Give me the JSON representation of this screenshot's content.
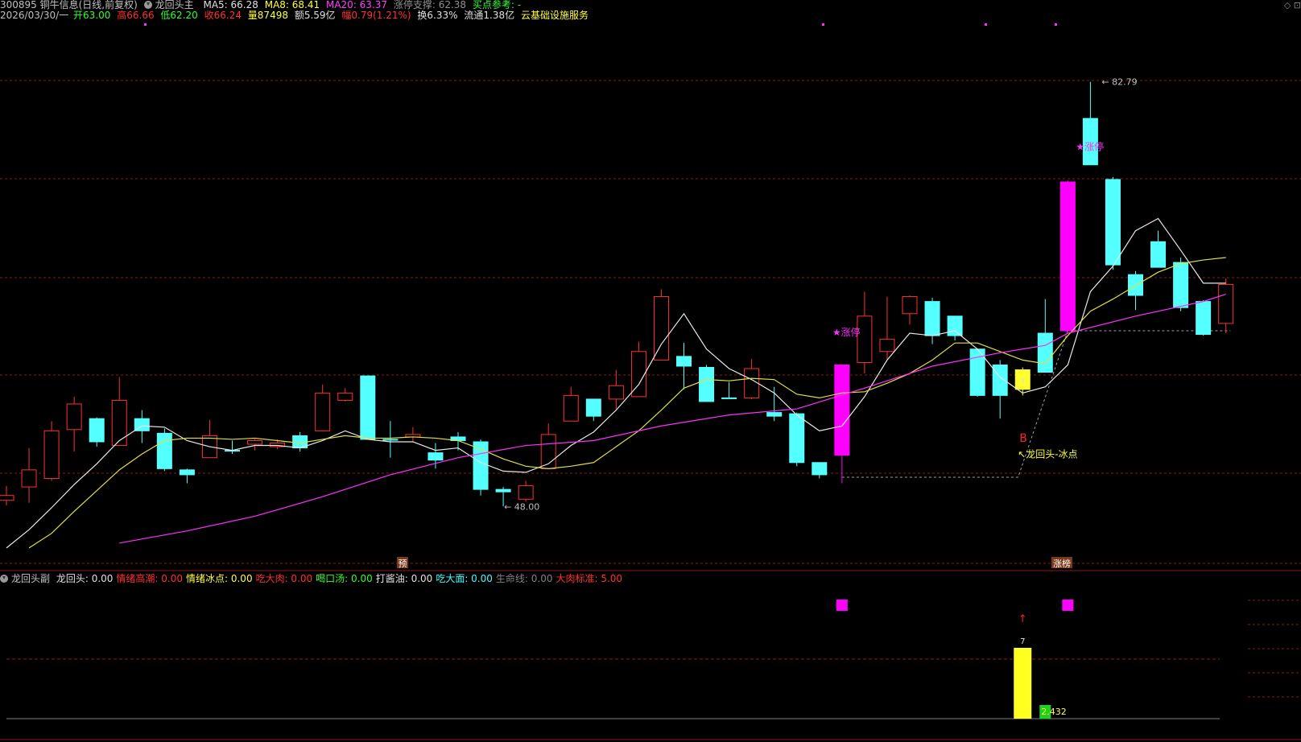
{
  "header": {
    "code_name": "300895 铜牛信息(日线,前复权)",
    "indicator_name": "龙回头主",
    "ma5": "MA5: 66.28",
    "ma8": "MA8: 68.41",
    "ma20": "MA20: 63.37",
    "limit_support": "涨停支撑: 62.38",
    "buy_ref": "买点参考: -",
    "date": "2026/03/30/一",
    "open": "开63.00",
    "high": "高66.66",
    "low": "低62.20",
    "close": "收66.24",
    "volume": "量87498",
    "amount": "额5.59亿",
    "change": "幅0.79(1.21%)",
    "turnover": "换6.33%",
    "float": "流通1.38亿",
    "concept": "云基础设施服务"
  },
  "sub_header": {
    "name": "龙回头副",
    "items": [
      {
        "label": "龙回头: 0.00",
        "color": "#e0e0e0"
      },
      {
        "label": "情绪高潮: 0.00",
        "color": "#ff3030"
      },
      {
        "label": "情绪冰点: 0.00",
        "color": "#ffff40"
      },
      {
        "label": "吃大肉: 0.00",
        "color": "#ff3030"
      },
      {
        "label": "喝口汤: 0.00",
        "color": "#30ff30"
      },
      {
        "label": "打酱油: 0.00",
        "color": "#e0e0e0"
      },
      {
        "label": "吃大面: 0.00",
        "color": "#40ffff"
      },
      {
        "label": "生命线: 0.00",
        "color": "#808080"
      },
      {
        "label": "大肉标准: 5.00",
        "color": "#ff3030"
      }
    ]
  },
  "top_right_icons": "◇ ⊡",
  "chart_data": {
    "type": "candlestick",
    "ylim": [
      44,
      87
    ],
    "high_label": "82.79",
    "low_label": "48.00",
    "candles": [
      [
        48.5,
        48.9,
        48.1,
        49.7
      ],
      [
        49.6,
        51.0,
        48.3,
        52.8
      ],
      [
        50.3,
        54.2,
        50.1,
        55.0
      ],
      [
        54.3,
        56.4,
        52.5,
        57.0
      ],
      [
        55.2,
        53.3,
        52.9,
        55.3
      ],
      [
        53.0,
        56.7,
        53.0,
        58.6
      ],
      [
        55.2,
        54.2,
        53.2,
        55.9
      ],
      [
        54.0,
        51.1,
        50.9,
        54.4
      ],
      [
        51.0,
        50.6,
        49.9,
        51.1
      ],
      [
        52.0,
        53.8,
        52.0,
        55.1
      ],
      [
        52.6,
        52.6,
        52.3,
        53.4
      ],
      [
        53.1,
        53.4,
        52.6,
        53.5
      ],
      [
        52.9,
        53.2,
        52.7,
        53.5
      ],
      [
        53.8,
        52.8,
        52.5,
        54.1
      ],
      [
        54.2,
        57.3,
        54.2,
        58.0
      ],
      [
        56.7,
        57.3,
        56.6,
        57.7
      ],
      [
        58.7,
        53.5,
        53.5,
        58.7
      ],
      [
        53.5,
        53.5,
        52.0,
        55.0
      ],
      [
        53.7,
        53.9,
        53.3,
        54.5
      ],
      [
        52.4,
        51.8,
        51.1,
        53.2
      ],
      [
        53.7,
        53.4,
        52.6,
        54.1
      ],
      [
        53.3,
        49.4,
        48.9,
        53.5
      ],
      [
        49.4,
        49.2,
        48.0,
        49.6
      ],
      [
        48.6,
        49.7,
        48.4,
        50.1
      ],
      [
        51.1,
        53.9,
        51.1,
        54.8
      ],
      [
        55.0,
        57.1,
        55.0,
        57.8
      ],
      [
        56.8,
        55.4,
        55.0,
        56.8
      ],
      [
        56.8,
        57.9,
        56.0,
        59.2
      ],
      [
        57.0,
        60.7,
        57.0,
        61.5
      ],
      [
        60.0,
        65.2,
        60.0,
        65.8
      ],
      [
        60.3,
        59.5,
        57.6,
        61.4
      ],
      [
        59.4,
        56.6,
        56.6,
        59.6
      ],
      [
        56.9,
        56.9,
        56.9,
        58.2
      ],
      [
        56.9,
        59.3,
        56.8,
        60.1
      ],
      [
        55.7,
        55.4,
        55.0,
        57.8
      ],
      [
        55.6,
        51.6,
        51.3,
        55.7
      ],
      [
        51.6,
        50.6,
        50.3,
        51.6
      ],
      [
        52.2,
        59.6,
        49.9,
        59.6
      ],
      [
        59.8,
        63.6,
        58.9,
        65.6
      ],
      [
        60.7,
        61.7,
        60.0,
        65.2
      ],
      [
        63.8,
        65.2,
        62.9,
        65.3
      ],
      [
        64.8,
        62.0,
        61.3,
        65.1
      ],
      [
        63.6,
        62.0,
        61.6,
        63.6
      ],
      [
        60.9,
        57.1,
        57.0,
        60.7
      ],
      [
        59.6,
        57.1,
        55.2,
        60.0
      ],
      [
        57.6,
        59.2,
        57.1,
        59.4
      ],
      [
        59.0,
        62.2,
        59.4,
        65.0
      ],
      [
        62.4,
        74.6,
        62.6,
        74.7
      ],
      [
        79.8,
        76.0,
        76.0,
        82.8
      ],
      [
        74.8,
        67.8,
        67.4,
        75.0
      ],
      [
        67.0,
        65.3,
        64.1,
        67.3
      ],
      [
        69.7,
        67.6,
        67.6,
        70.6
      ],
      [
        68.0,
        64.3,
        64.0,
        68.4
      ],
      [
        64.8,
        62.1,
        62.0,
        64.9
      ],
      [
        63.0,
        66.2,
        62.2,
        66.7
      ]
    ],
    "colors": [
      "#ff3030",
      "#ff3030",
      "#ff3030",
      "#ff3030",
      "#54ffff",
      "#ff3030",
      "#54ffff",
      "#54ffff",
      "#54ffff",
      "#ff3030",
      "#54ffff",
      "#ff3030",
      "#ff3030",
      "#54ffff",
      "#ff3030",
      "#ff3030",
      "#54ffff",
      "#54ffff",
      "#ff3030",
      "#54ffff",
      "#54ffff",
      "#54ffff",
      "#54ffff",
      "#ff3030",
      "#ff3030",
      "#ff3030",
      "#54ffff",
      "#ff3030",
      "#ff3030",
      "#ff3030",
      "#54ffff",
      "#54ffff",
      "#54ffff",
      "#ff3030",
      "#54ffff",
      "#54ffff",
      "#54ffff",
      "#ff00ff",
      "#ff3030",
      "#ff3030",
      "#ff3030",
      "#54ffff",
      "#54ffff",
      "#54ffff",
      "#54ffff",
      "#ffff30",
      "#54ffff",
      "#ff00ff",
      "#54ffff",
      "#54ffff",
      "#54ffff",
      "#54ffff",
      "#54ffff",
      "#54ffff",
      "#ff3030"
    ],
    "ma5": [
      44.6,
      46.1,
      47.9,
      49.8,
      51.5,
      53.4,
      54.6,
      54.5,
      53.4,
      52.9,
      52.6,
      53.0,
      53.0,
      52.8,
      53.4,
      54.2,
      53.5,
      53.3,
      53.3,
      52.6,
      52.8,
      51.6,
      50.9,
      50.8,
      51.5,
      53.0,
      54.1,
      55.9,
      58.0,
      61.3,
      63.8,
      60.9,
      59.3,
      58.4,
      57.3,
      55.5,
      54.2,
      54.6,
      57.0,
      60.0,
      62.2,
      62.0,
      62.4,
      60.9,
      58.6,
      57.3,
      57.8,
      59.6,
      65.6,
      67.7,
      70.6,
      71.6,
      69.0,
      66.3,
      66.3
    ],
    "ma8": [
      null,
      44.6,
      45.8,
      47.6,
      49.3,
      51.0,
      52.3,
      53.4,
      53.6,
      53.6,
      53.5,
      53.6,
      53.4,
      53.2,
      53.5,
      53.8,
      53.6,
      53.6,
      53.7,
      53.6,
      53.4,
      52.7,
      51.9,
      51.3,
      51.1,
      51.3,
      51.6,
      52.9,
      54.2,
      55.9,
      57.7,
      58.4,
      58.3,
      58.5,
      58.4,
      57.2,
      56.9,
      57.3,
      57.4,
      58.1,
      58.9,
      60.0,
      61.4,
      61.4,
      60.7,
      60.0,
      59.7,
      62.0,
      64.0,
      65.0,
      66.1,
      67.2,
      67.9,
      68.2,
      68.4
    ],
    "ma20": [
      null,
      null,
      null,
      null,
      null,
      null,
      null,
      null,
      null,
      null,
      null,
      null,
      null,
      null,
      null,
      null,
      null,
      null,
      null,
      null,
      null,
      null,
      null,
      null,
      null,
      null,
      null,
      null,
      null,
      null,
      null,
      null,
      null,
      null,
      null,
      null,
      null,
      null,
      null,
      null,
      null,
      null,
      null,
      null,
      null,
      null,
      null,
      null,
      null,
      null,
      null,
      null,
      null,
      null,
      63.4
    ],
    "ma20_points": [
      [
        5,
        45.0
      ],
      [
        8,
        46.0
      ],
      [
        11,
        47.2
      ],
      [
        14,
        48.8
      ],
      [
        17,
        50.6
      ],
      [
        20,
        52.0
      ],
      [
        23,
        53.0
      ],
      [
        26,
        53.4
      ],
      [
        29,
        54.6
      ],
      [
        32,
        55.5
      ],
      [
        35,
        56.0
      ],
      [
        38,
        57.7
      ],
      [
        41,
        59.5
      ],
      [
        44,
        60.6
      ],
      [
        46,
        61.2
      ],
      [
        47,
        62.2
      ],
      [
        50,
        63.6
      ],
      [
        53,
        64.8
      ],
      [
        54,
        65.4
      ]
    ],
    "labels": {
      "limit1": "★涨停",
      "limit2": "★涨停",
      "pullback": "↖龙回头-冰点",
      "b_mark": "B",
      "seven": "7",
      "bottom_tag1": "预",
      "bottom_tag2": "涨榜"
    },
    "sub": {
      "bar_value_label": "7",
      "green_value_label": "2.432",
      "arrow": "↑"
    }
  }
}
